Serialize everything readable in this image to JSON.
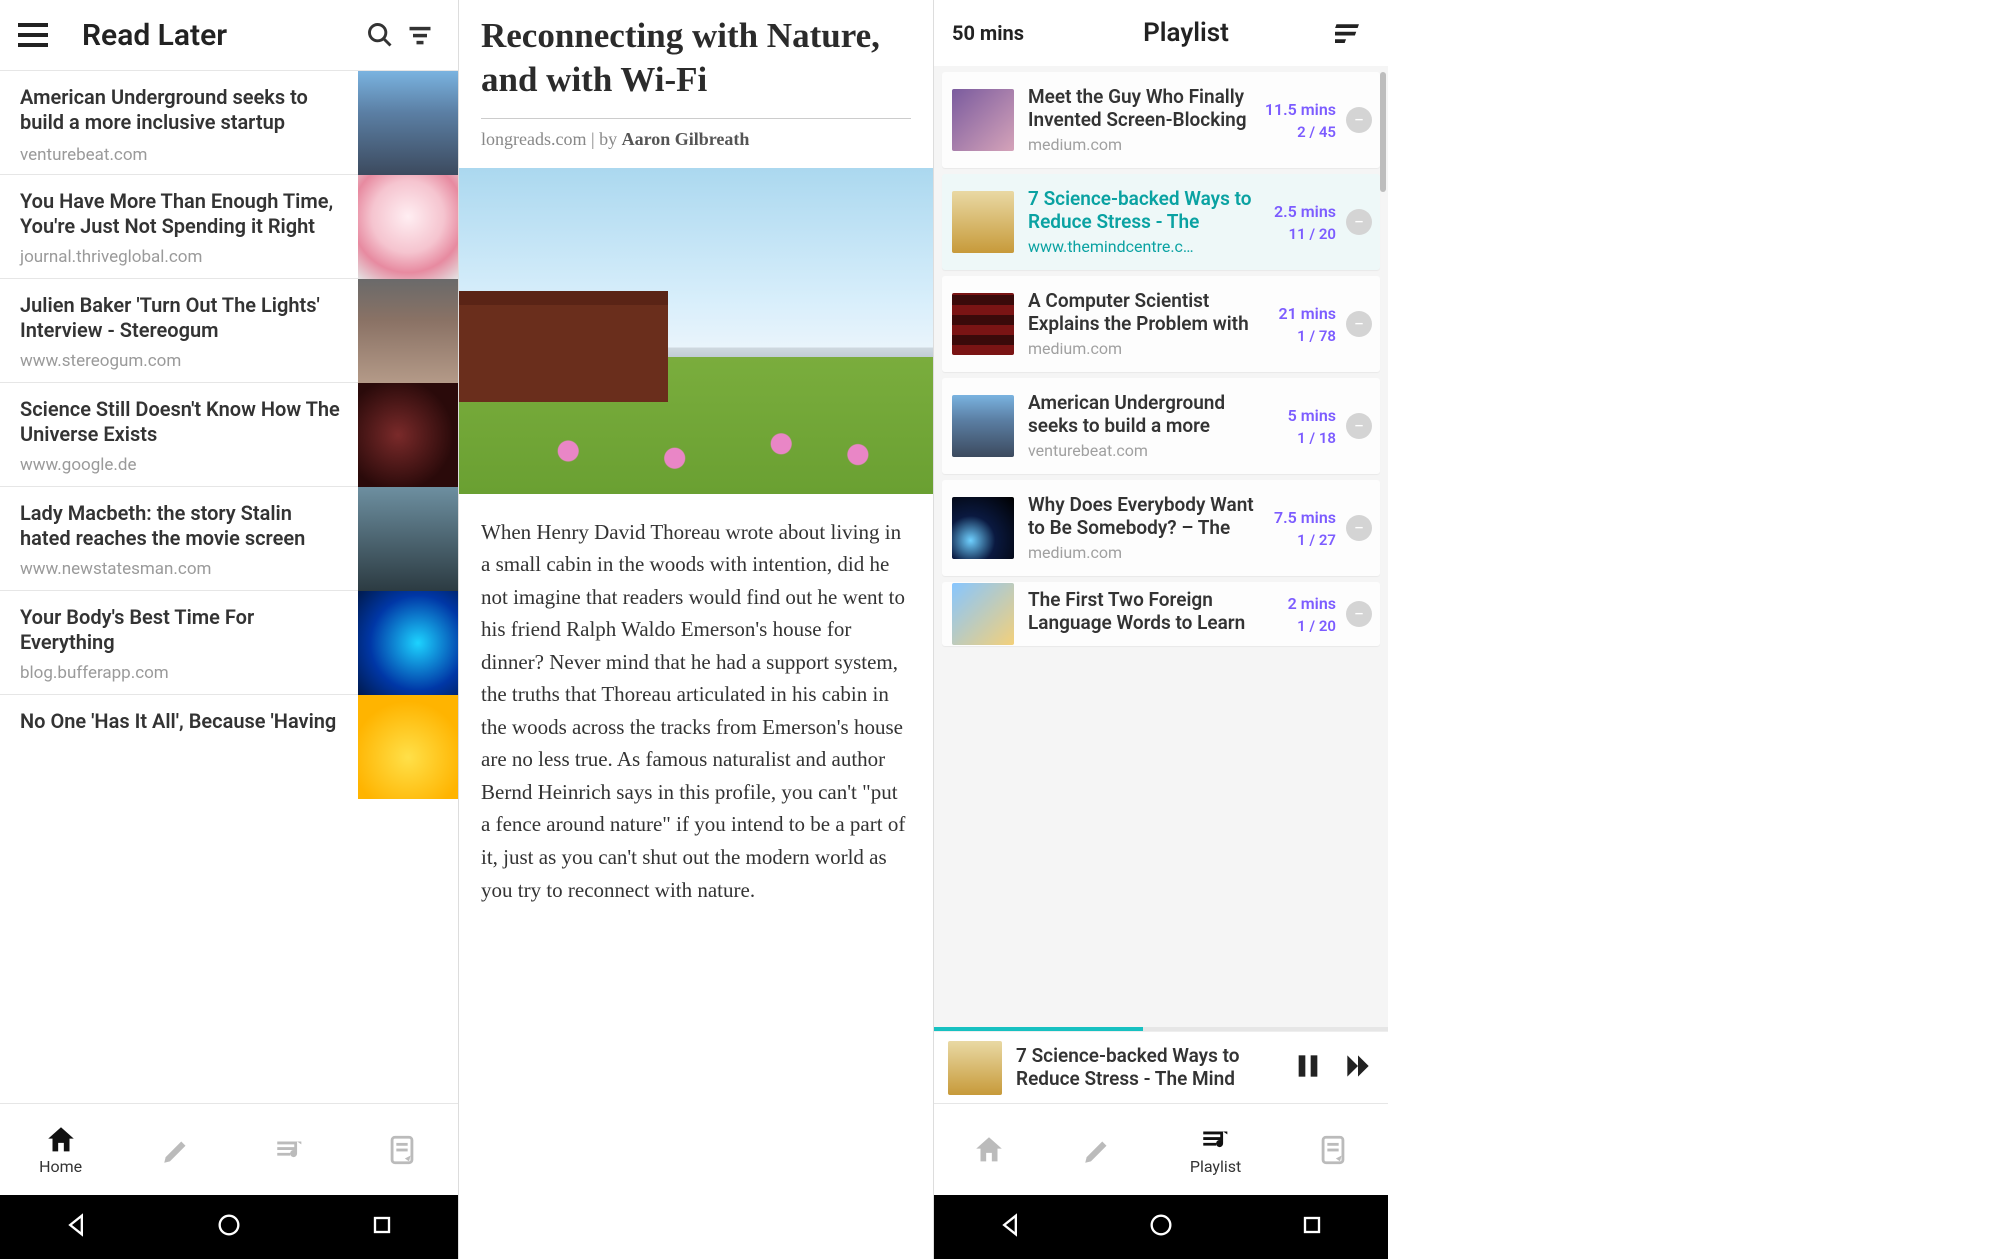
{
  "left": {
    "title": "Read Later",
    "nav": {
      "home": "Home"
    },
    "articles": [
      {
        "title": "American Underground seeks to build a more inclusive startup community in",
        "source": "venturebeat.com",
        "thumb": "th-city"
      },
      {
        "title": "You Have More Than Enough Time, You're Just Not Spending it Right",
        "source": "journal.thriveglobal.com",
        "thumb": "th-hour"
      },
      {
        "title": "Julien Baker 'Turn Out The Lights' Interview - Stereogum",
        "source": "www.stereogum.com",
        "thumb": "th-person"
      },
      {
        "title": "Science Still Doesn't Know How The Universe Exists",
        "source": "www.google.de",
        "thumb": "th-space"
      },
      {
        "title": "Lady Macbeth: the story Stalin hated reaches the movie screen",
        "source": "www.newstatesman.com",
        "thumb": "th-period"
      },
      {
        "title": "Your Body's Best Time For Everything",
        "source": "blog.bufferapp.com",
        "thumb": "th-tech"
      },
      {
        "title": "No One 'Has It All', Because 'Having It",
        "source": "",
        "thumb": "th-sun"
      }
    ]
  },
  "mid": {
    "title": "Reconnecting with Nature, and with Wi-Fi",
    "domain": "longreads.com",
    "by": " | by ",
    "author": "Aaron Gilbreath",
    "body": "When Henry David Thoreau wrote about living in a small cabin in the woods with intention, did he not imagine that readers would find out he went to his friend Ralph Waldo Emerson's house for dinner? Never mind that he had a support system, the truths that Thoreau articulated in his cabin in the woods across the tracks from Emerson's house are no less true. As famous naturalist and author Bernd Heinrich says in this profile, you can't \"put a fence around nature\" if you intend to be a part of it, just as you can't shut out the modern world as you try to reconnect with nature."
  },
  "right": {
    "duration": "50 mins",
    "title": "Playlist",
    "nav": {
      "playlist": "Playlist"
    },
    "progress_percent": 46,
    "items": [
      {
        "title": "Meet the Guy Who Finally Invented Screen-Blocking",
        "source": "medium.com",
        "mins": "11.5 mins",
        "progress": "2 / 45",
        "thumb": "th-phone",
        "active": false
      },
      {
        "title": "7 Science-backed Ways to Reduce Stress - The",
        "source": "www.themindcentre.c…",
        "mins": "2.5 mins",
        "progress": "11 / 20",
        "thumb": "th-arms",
        "active": true
      },
      {
        "title": "A Computer Scientist Explains the Problem with",
        "source": "medium.com",
        "mins": "21 mins",
        "progress": "1 / 78",
        "thumb": "th-seats",
        "active": false
      },
      {
        "title": "American Underground seeks to build a more",
        "source": "venturebeat.com",
        "mins": "5 mins",
        "progress": "1 / 18",
        "thumb": "th-city",
        "active": false
      },
      {
        "title": "Why Does Everybody Want to Be Somebody? – The",
        "source": "medium.com",
        "mins": "7.5 mins",
        "progress": "1 / 27",
        "thumb": "th-comet",
        "active": false
      },
      {
        "title": "The First Two Foreign Language Words to Learn",
        "source": "",
        "mins": "2 mins",
        "progress": "1 / 20",
        "thumb": "th-flags",
        "active": false
      }
    ],
    "mini": {
      "title": "7 Science-backed Ways to Reduce Stress - The Mind",
      "thumb": "th-arms"
    }
  }
}
